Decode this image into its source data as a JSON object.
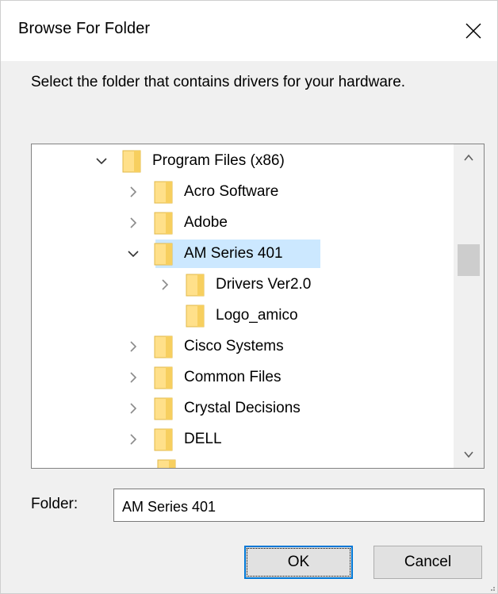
{
  "window": {
    "title": "Browse For Folder"
  },
  "instructions": "Select the folder that contains drivers for your hardware.",
  "tree": {
    "rows": [
      {
        "label": "Program Files (x86)",
        "expander": "expanded",
        "icon": "folder-icon"
      },
      {
        "label": "Acro Software",
        "expander": "collapsed",
        "icon": "folder-icon"
      },
      {
        "label": "Adobe",
        "expander": "collapsed",
        "icon": "folder-icon"
      },
      {
        "label": "AM Series 401",
        "expander": "expanded",
        "icon": "folder-icon",
        "selected": true
      },
      {
        "label": "Drivers Ver2.0",
        "expander": "collapsed",
        "icon": "folder-icon"
      },
      {
        "label": "Logo_amico",
        "expander": "none",
        "icon": "folder-icon"
      },
      {
        "label": "Cisco Systems",
        "expander": "collapsed",
        "icon": "folder-icon"
      },
      {
        "label": "Common Files",
        "expander": "collapsed",
        "icon": "folder-icon"
      },
      {
        "label": "Crystal Decisions",
        "expander": "collapsed",
        "icon": "folder-icon"
      },
      {
        "label": "DELL",
        "expander": "collapsed",
        "icon": "folder-icon"
      }
    ]
  },
  "folder": {
    "label": "Folder:",
    "value": "AM Series 401"
  },
  "buttons": {
    "ok": "OK",
    "cancel": "Cancel"
  },
  "colors": {
    "selection": "#cce8ff",
    "folder_fill": "#ffe08a",
    "folder_edge": "#e0b84a",
    "accent": "#0078d7"
  }
}
